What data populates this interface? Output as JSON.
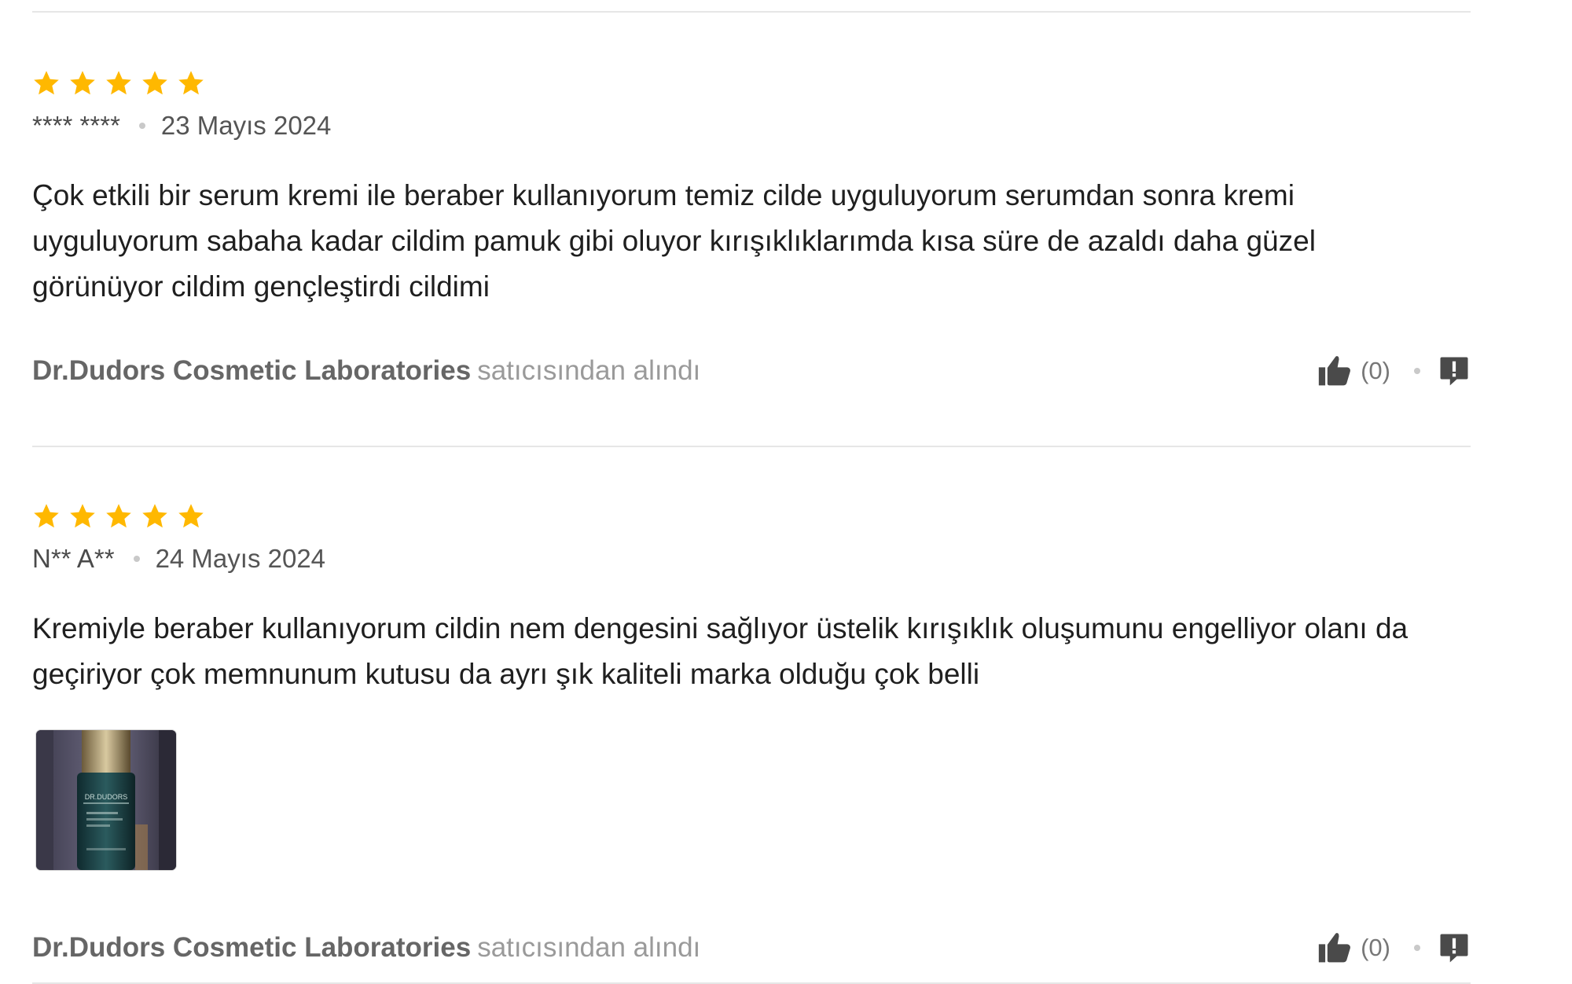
{
  "colors": {
    "star": "#FFB800",
    "divider": "#E6E6E6",
    "seller": "#666666",
    "icon": "#4A4A4A"
  },
  "reviews": [
    {
      "rating": 5,
      "author": "**** ****",
      "date": "23 Mayıs 2024",
      "comment_lines": [
        "Çok etkili bir serum kremi ile beraber kullanıyorum temiz cilde uyguluyorum serumdan sonra kremi",
        "uyguluyorum sabaha kadar cildim pamuk gibi oluyor kırışıklıklarımda kısa süre de azaldı daha güzel",
        "görünüyor cildim gençleştirdi cildimi"
      ],
      "seller": "Dr.Dudors Cosmetic Laboratories",
      "seller_suffix": "satıcısından alındı",
      "like_count": "(0)",
      "like_icon": "thumbs-up-icon",
      "report_icon": "report-flag-icon"
    },
    {
      "rating": 5,
      "author": "N** A**",
      "date": "24 Mayıs 2024",
      "comment_lines": [
        "Kremiyle beraber kullanıyorum cildin nem dengesini sağlıyor üstelik kırışıklık oluşumunu engelliyor olanı da",
        "geçiriyor çok memnunum kutusu da ayrı şık kaliteli marka olduğu çok belli"
      ],
      "has_photo": true,
      "photo_label": "DR.DUDORS",
      "seller": "Dr.Dudors Cosmetic Laboratories",
      "seller_suffix": "satıcısından alındı",
      "like_count": "(0)",
      "like_icon": "thumbs-up-icon",
      "report_icon": "report-flag-icon"
    }
  ]
}
